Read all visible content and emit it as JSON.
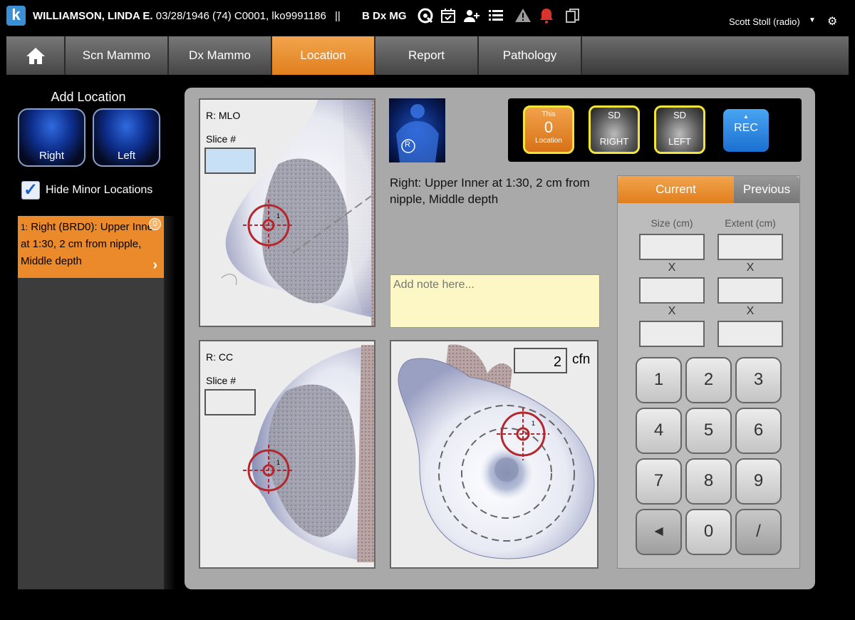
{
  "header": {
    "logo": "k",
    "patient_name": "WILLIAMSON, LINDA E.",
    "patient_info": "03/28/1946 (74) C0001, lko9991186",
    "separator": "||",
    "study": "B Dx MG",
    "user": "Scott Stoll (radio)",
    "icons": [
      "search-q-icon",
      "calendar-check-icon",
      "add-user-icon",
      "list-icon",
      "warning-icon",
      "bell-icon",
      "copy-icon"
    ]
  },
  "tabs": [
    "Scn Mammo",
    "Dx Mammo",
    "Location",
    "Report",
    "Pathology"
  ],
  "active_tab": "Location",
  "left": {
    "title": "Add Location",
    "right_label": "Right",
    "left_label": "Left",
    "hide_minor_label": "Hide Minor Locations",
    "hide_minor_checked": true,
    "item_number": "1:",
    "item_text": "Right (BRD0): Upper Inner at 1:30, 2 cm from nipple, Middle depth",
    "item_badge": "0"
  },
  "views": {
    "mlo_label": "R: MLO",
    "mlo_slice_label": "Slice #",
    "cc_label": "R: CC",
    "cc_slice_label": "Slice #",
    "marker_num": "1"
  },
  "location_text": "Right: Upper Inner at 1:30, 2 cm from nipple, Middle depth",
  "thumb_label": "R",
  "note_placeholder": "Add note here...",
  "buttons": {
    "this_top": "This",
    "this_count": "0",
    "this_bottom": "Location",
    "sd_right_top": "SD",
    "sd_right_bottom": "RIGHT",
    "sd_left_top": "SD",
    "sd_left_bottom": "LEFT",
    "rec": "REC"
  },
  "clock": {
    "distance": "2",
    "unit": "cfn"
  },
  "measure": {
    "tab_current": "Current",
    "tab_previous": "Previous",
    "size_label": "Size (cm)",
    "extent_label": "Extent (cm)",
    "x": "X"
  },
  "keypad": [
    "1",
    "2",
    "3",
    "4",
    "5",
    "6",
    "7",
    "8",
    "9",
    "◀",
    "0",
    "/"
  ],
  "colors": {
    "accent": "#ea8a2b",
    "rec": "#1b6fd0",
    "highlight": "#f2e43a",
    "marker": "#b3272d"
  }
}
